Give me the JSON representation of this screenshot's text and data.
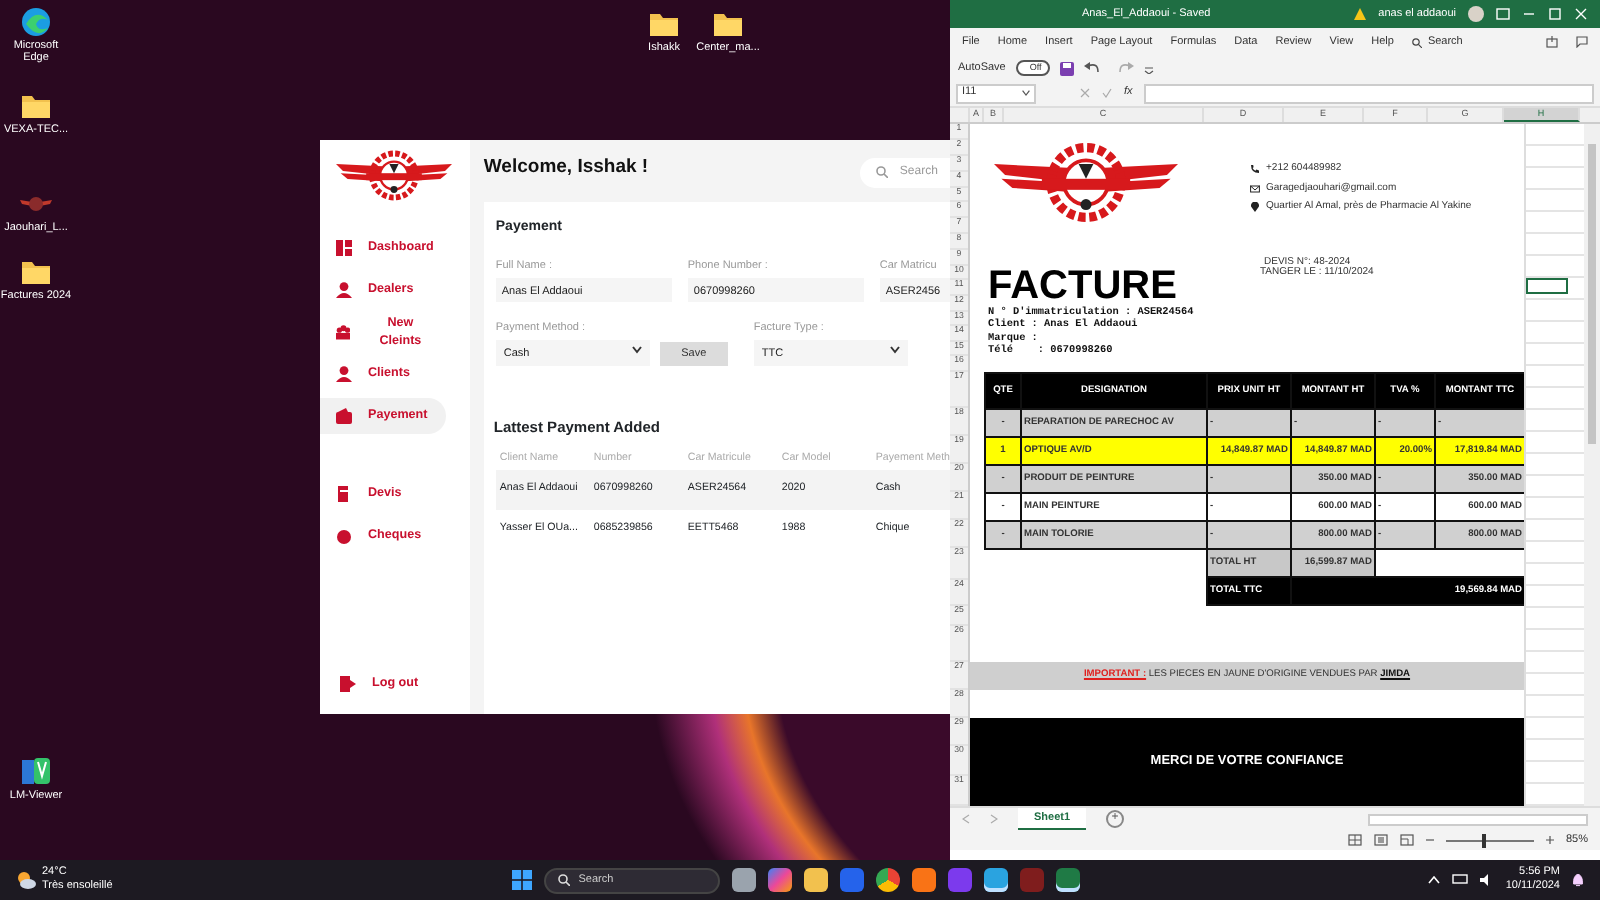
{
  "desktop_icons": [
    {
      "label": "Microsoft Edge",
      "kind": "browser"
    },
    {
      "label": "VEXA-TEC...",
      "kind": "folder"
    },
    {
      "label": "Jaouhari_L...",
      "kind": "logo"
    },
    {
      "label": "Factures 2024",
      "kind": "folder"
    },
    {
      "label": "LM-Viewer",
      "kind": "app"
    },
    {
      "label": "Ishakk",
      "kind": "folder"
    },
    {
      "label": "Center_ma...",
      "kind": "folder"
    }
  ],
  "app": {
    "welcome": "Welcome, Isshak !",
    "search_placeholder": "Search",
    "sidebar": {
      "items": [
        {
          "label": "Dashboard",
          "kind": "grid",
          "selected": false
        },
        {
          "label": "Dealers",
          "kind": "user",
          "selected": false
        },
        {
          "label": "New Cleints",
          "kind": "group",
          "selected": false
        },
        {
          "label": "Clients",
          "kind": "user",
          "selected": false
        },
        {
          "label": "Payement",
          "kind": "wallet",
          "selected": true
        },
        {
          "label": "Devis",
          "kind": "document",
          "selected": false
        },
        {
          "label": "Cheques",
          "kind": "coin",
          "selected": false
        }
      ],
      "logout": "Log out"
    },
    "form": {
      "title": "Payement",
      "fields": [
        {
          "label": "Full Name :",
          "value": "Anas El Addaoui"
        },
        {
          "label": "Phone Number :",
          "value": "0670998260"
        },
        {
          "label": "Car Matricu",
          "value": "ASER2456"
        }
      ],
      "selects": [
        {
          "label": "Payment Method :",
          "value": "Cash",
          "button": "Save"
        },
        {
          "label": "Facture Type :",
          "value": "TTC"
        }
      ]
    },
    "table": {
      "title": "Lattest Payment Added",
      "columns": [
        "Client Name",
        "Number",
        "Car Matricule",
        "Car Model",
        "Payement Meth"
      ],
      "rows": [
        {
          "cells": [
            "Anas El Addaoui",
            "0670998260",
            "ASER24564",
            "2020",
            "Cash"
          ],
          "selected": true
        },
        {
          "cells": [
            "Yasser El OUa...",
            "0685239856",
            "EETT5468",
            "1988",
            "Chique"
          ],
          "selected": false
        }
      ]
    }
  },
  "excel": {
    "title": "Anas_El_Addaoui - Saved",
    "user": "anas el addaoui",
    "menu": [
      "File",
      "Home",
      "Insert",
      "Page Layout",
      "Formulas",
      "Data",
      "Review",
      "View",
      "Help"
    ],
    "search": "Search",
    "autosave": {
      "label": "AutoSave",
      "state_text": "Off",
      "on": false
    },
    "name_box": "I11",
    "fx": "fx",
    "columns": [
      "A",
      "B",
      "C",
      "D",
      "E",
      "F",
      "G",
      "H"
    ],
    "rows": [
      "1",
      "2",
      "3",
      "4",
      "5",
      "6",
      "7",
      "8",
      "9",
      "10",
      "11",
      "12",
      "13",
      "14",
      "15",
      "16",
      "17",
      "18",
      "19",
      "20",
      "21",
      "22",
      "23",
      "24",
      "25",
      "26",
      "27",
      "28",
      "29",
      "30",
      "31"
    ],
    "sheet_tabs": [
      {
        "label": "Sheet1",
        "selected": true
      }
    ],
    "add_sheet": "+",
    "zoom": "85%",
    "zoom_slider": {
      "level": 0.4
    },
    "invoice": {
      "phone": "+212 604489982",
      "email": "Garagedjaouhari@gmail.com",
      "address": "Quartier Al Amal, près de Pharmacie Al Yakine",
      "devis": "DEVIS N°: 48-2024",
      "date": "TANGER LE : 11/10/2024",
      "title": "FACTURE",
      "info": [
        "N ° D'immatriculation : ASER24564",
        "Client : Anas El Addaoui",
        "Marque :",
        "Télé    : 0670998260"
      ],
      "columns": [
        "QTE",
        "DESIGNATION",
        "PRIX UNIT HT",
        "MONTANT HT",
        "TVA %",
        "MONTANT TTC"
      ],
      "rows": [
        {
          "cells": [
            "-",
            "REPARATION DE PARECHOC AV",
            "-",
            "-",
            "-",
            "-"
          ],
          "color": "#d0d0d0"
        },
        {
          "cells": [
            "1",
            "OPTIQUE AV/D",
            "14,849.87 MAD",
            "14,849.87 MAD",
            "20.00%",
            "17,819.84 MAD"
          ],
          "color": "#ffff00"
        },
        {
          "cells": [
            "-",
            "PRODUIT DE PEINTURE",
            "-",
            "350.00 MAD",
            "-",
            "350.00 MAD"
          ],
          "color": "#d0d0d0"
        },
        {
          "cells": [
            "-",
            "MAIN PEINTURE",
            "-",
            "600.00 MAD",
            "-",
            "600.00 MAD"
          ],
          "color": "#ffffff"
        },
        {
          "cells": [
            "-",
            "MAIN TOLORIE",
            "-",
            "800.00 MAD",
            "-",
            "800.00 MAD"
          ],
          "color": "#d0d0d0"
        }
      ],
      "totals": [
        {
          "label": "TOTAL HT",
          "value": "16,599.87 MAD",
          "kind": "light"
        },
        {
          "label": "TOTAL TTC",
          "value": "19,569.84 MAD",
          "kind": "dark"
        }
      ],
      "note": {
        "label": "IMPORTANT :",
        "text": "LES PIECES  EN JAUNE  D'ORIGINE VENDUES PAR",
        "vendor": "JIMDA"
      },
      "thanks": "MERCI DE VOTRE CONFIANCE"
    }
  },
  "taskbar": {
    "weather": {
      "temp": "24°C",
      "text": "Très ensoleillé"
    },
    "search_placeholder": "Search",
    "apps": [
      {
        "kind": "window",
        "active": false
      },
      {
        "kind": "copilot",
        "active": false
      },
      {
        "kind": "folder",
        "active": false
      },
      {
        "kind": "store",
        "active": false
      },
      {
        "kind": "chrome",
        "active": false
      },
      {
        "kind": "orange",
        "active": false
      },
      {
        "kind": "vs",
        "active": false
      },
      {
        "kind": "telegram",
        "active": true
      },
      {
        "kind": "dark",
        "active": false
      },
      {
        "kind": "excel",
        "active": true
      }
    ],
    "time": "5:56 PM",
    "date": "10/11/2024"
  }
}
